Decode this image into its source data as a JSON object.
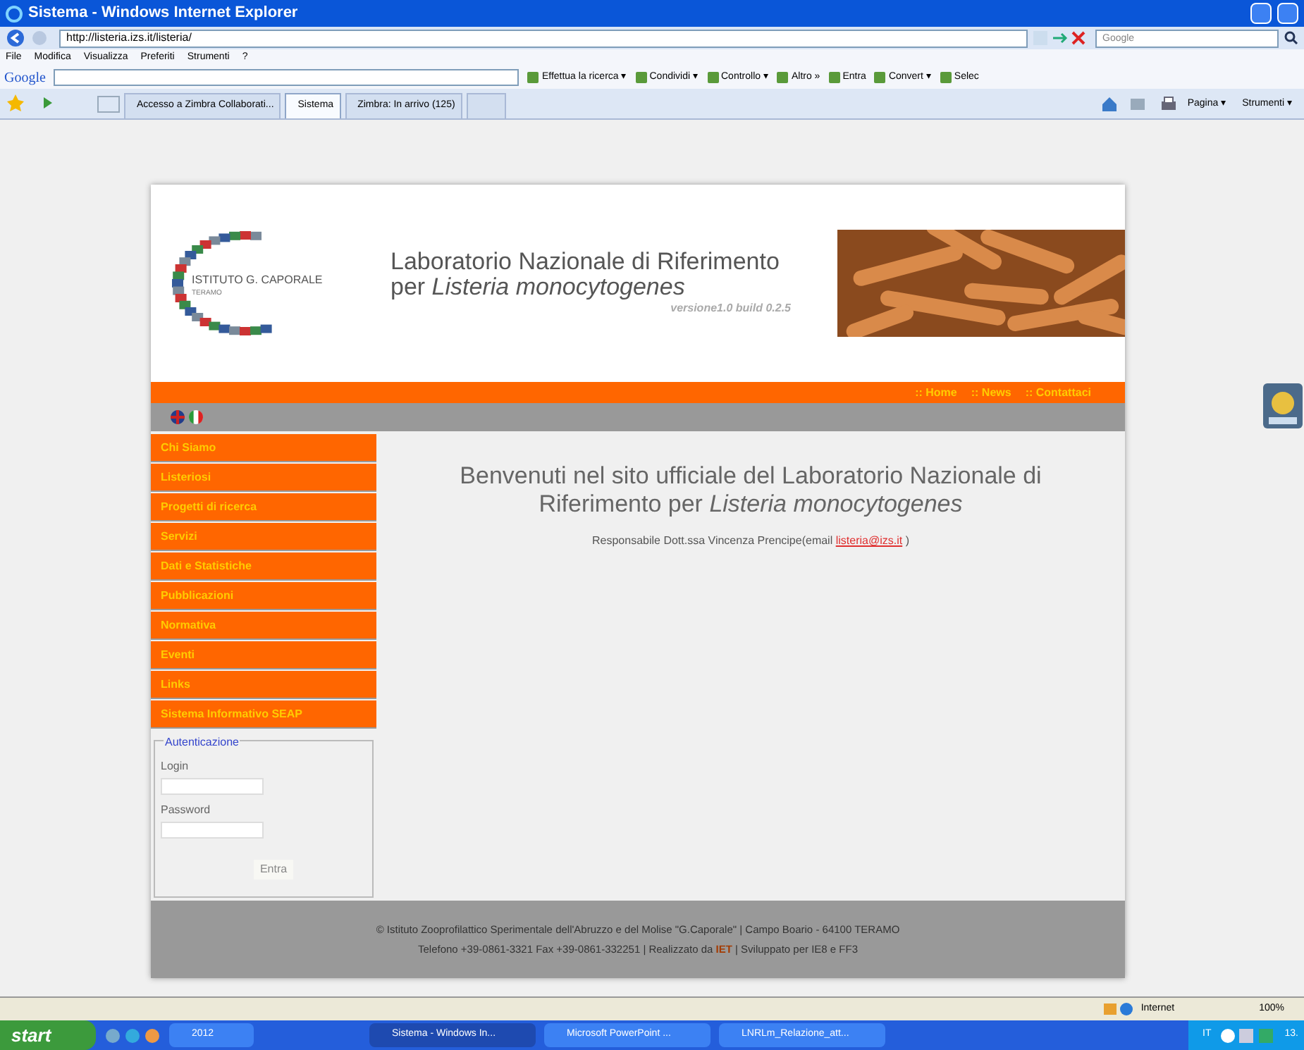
{
  "window": {
    "title": "Sistema - Windows Internet Explorer"
  },
  "address_bar": {
    "url": "http://listeria.izs.it/listeria/",
    "search_placeholder": "Google"
  },
  "menu_bar": [
    "File",
    "Modifica",
    "Visualizza",
    "Preferiti",
    "Strumenti",
    "?"
  ],
  "google_toolbar": {
    "logo": "Google",
    "items": [
      "Effettua la ricerca ▾",
      "Condividi ▾",
      "Controllo ▾",
      "Altro »",
      "Entra",
      "Convert ▾",
      "Selec"
    ]
  },
  "tabs": [
    {
      "label": "Accesso a Zimbra Collaborati...",
      "selected": false
    },
    {
      "label": "Sistema",
      "selected": true
    },
    {
      "label": "Zimbra: In arrivo (125)",
      "selected": false
    }
  ],
  "command_bar": [
    "Pagina ▾",
    "Strumenti ▾"
  ],
  "site": {
    "logo_name": "ISTITUTO G. CAPORALE",
    "logo_city": "TERAMO",
    "title_line_1": "Laboratorio Nazionale di Riferimento",
    "title_line_2": "per *Listeria monocytogenes*",
    "version": "versione1.0 build 0.2.5",
    "top_nav": [
      ":: Home",
      ":: News",
      ":: Contattaci"
    ],
    "side_menu": [
      "Chi Siamo",
      "Listeriosi",
      "Progetti di ricerca",
      "Servizi",
      "Dati e Statistiche",
      "Pubblicazioni",
      "Normativa",
      "Eventi",
      "Links",
      "Sistema Informativo SEAP"
    ],
    "welcome": "Benvenuti nel sito ufficiale del Laboratorio Nazionale di Riferimento per *Listeria monocytogenes*",
    "responsible": {
      "text": "Responsabile Dott.ssa Vincenza Prencipe(email ",
      "link": "listeria@izs.it",
      "after": " )"
    },
    "login": {
      "legend": "Autenticazione",
      "login_label": "Login",
      "password_label": "Password",
      "button": "Entra"
    },
    "footer": {
      "line_1": "© Istituto Zooprofilattico Sperimentale dell'Abruzzo e del Molise \"G.Caporale\" | Campo Boario - 64100 TERAMO",
      "line_2_before": "Telefono +39-0861-3321 Fax +39-0861-332251 | Realizzato da ",
      "line_2_link": "IET",
      "line_2_after": " | Sviluppato per IE8 e FF3"
    }
  },
  "status_bar": {
    "zone": "Internet",
    "zoom": "100%"
  },
  "taskbar": {
    "start": "start",
    "folder": "2012",
    "windows": [
      {
        "label": "Sistema - Windows In...",
        "selected": true
      },
      {
        "label": "Microsoft PowerPoint ...",
        "selected": false
      },
      {
        "label": "LNRLm_Relazione_att...",
        "selected": false
      }
    ],
    "language": "IT",
    "clock": "13."
  }
}
